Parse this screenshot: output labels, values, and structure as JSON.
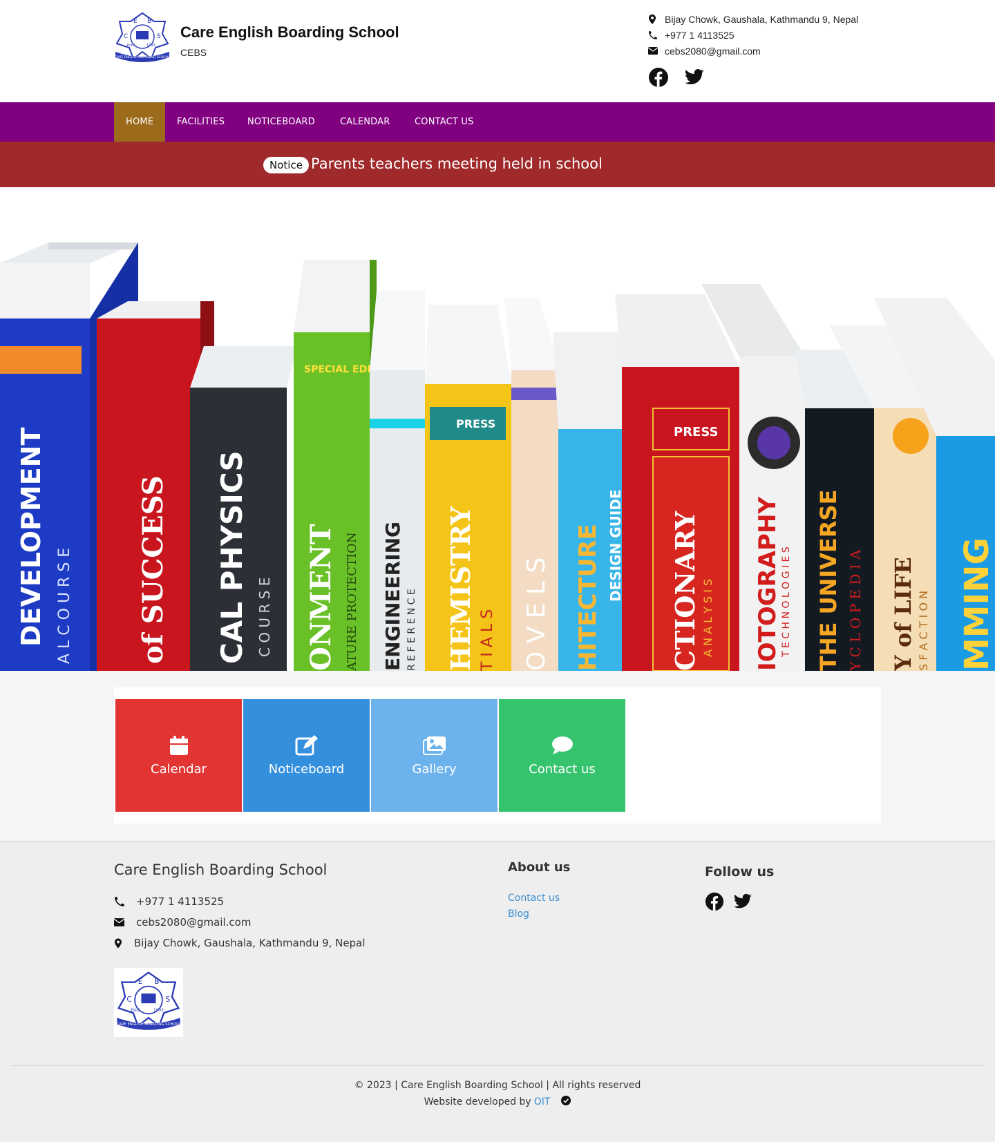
{
  "header": {
    "school_name": "Care English Boarding School",
    "school_abbr": "CEBS",
    "address": "Bijay Chowk, Gaushala, Kathmandu 9, Nepal",
    "phone": "+977 1 4113525",
    "email": "cebs2080@gmail.com",
    "logo": {
      "top_letters": [
        "E",
        "B"
      ],
      "side_letters": [
        "C",
        "S"
      ],
      "estd": "Estd.",
      "year": "1993",
      "ribbon": "CARE ENGLISH BOARDING SCHOOL"
    },
    "social_icons": [
      "facebook-icon",
      "twitter-icon"
    ]
  },
  "nav": {
    "items": [
      {
        "label": "HOME",
        "active": true
      },
      {
        "label": "FACILITIES",
        "active": false
      },
      {
        "label": "NOTICEBOARD",
        "active": false
      },
      {
        "label": "CALENDAR",
        "active": false
      },
      {
        "label": "CONTACT US",
        "active": false
      }
    ]
  },
  "notice": {
    "badge": "Notice",
    "text": "Parents teachers meeting held in school"
  },
  "banner": {
    "book_spines": [
      "DEVELOPMENT",
      "A L  C O U R S E",
      "of SUCCESS",
      "CAL PHYSICS",
      "C O U R S E",
      "SPECIAL EDITION",
      "ONMENT",
      "ATURE PROTECTION",
      "ENGINEERING",
      "R E F E R E N C E",
      "PRESS",
      "HEMISTRY",
      "T I A L S",
      "O V E L S",
      "HITECTURE",
      "DESIGN GUIDE",
      "PRESS",
      "CTIONARY",
      "A N A L Y S I S",
      "IOTOGRAPHY",
      "T E C H N O L O G I E S",
      "THE UNIVERSE",
      "Y C L O P E D I A",
      "Y of LIFE",
      "S F A C T I O N",
      "MMING"
    ]
  },
  "tiles": [
    {
      "label": "Calendar",
      "icon": "calendar-icon",
      "color": "#e33434"
    },
    {
      "label": "Noticeboard",
      "icon": "edit-icon",
      "color": "#348fdd"
    },
    {
      "label": "Gallery",
      "icon": "images-icon",
      "color": "#6cb2ec"
    },
    {
      "label": "Contact us",
      "icon": "chat-icon",
      "color": "#36c36e"
    }
  ],
  "footer": {
    "school_name": "Care English Boarding School",
    "phone": "+977 1 4113525",
    "email": "cebs2080@gmail.com",
    "address": "Bijay Chowk, Gaushala, Kathmandu 9, Nepal",
    "about_title": "About us",
    "about_links": [
      "Contact us",
      "Blog"
    ],
    "follow_title": "Follow us",
    "copyright": "© 2023 | Care English Boarding School | All rights reserved",
    "developed_by_prefix": "Website developed by",
    "developer": "OIT"
  },
  "colors": {
    "nav_bg": "#800080",
    "nav_active": "#9b6a1a",
    "notice_bg": "#a0292b",
    "link": "#3a8ed1"
  }
}
